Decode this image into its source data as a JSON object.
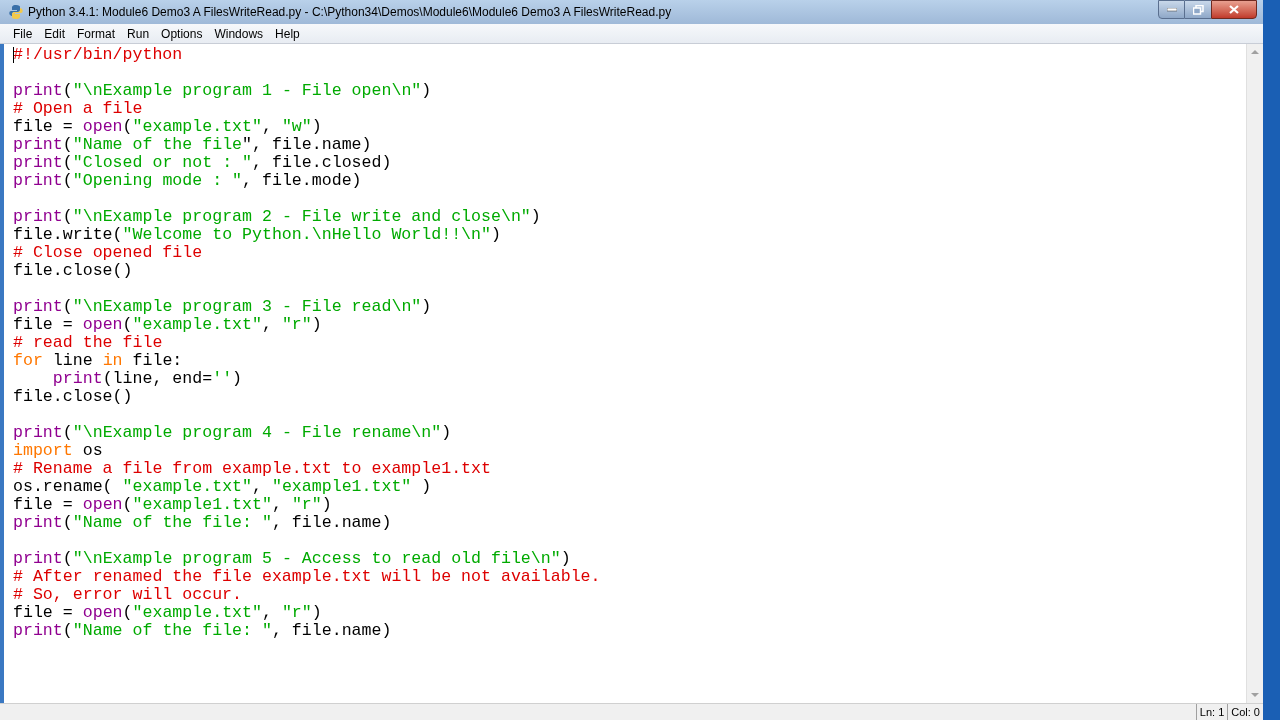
{
  "window": {
    "title": "Python 3.4.1: Module6 Demo3 A FilesWriteRead.py - C:\\Python34\\Demos\\Module6\\Module6 Demo3 A FilesWriteRead.py"
  },
  "menu": [
    "File",
    "Edit",
    "Format",
    "Run",
    "Options",
    "Windows",
    "Help"
  ],
  "code_lines": [
    {
      "kind": "code",
      "tokens": [
        {
          "kind": "comment",
          "text": "#!/usr/bin/python"
        }
      ]
    },
    {
      "kind": "blank"
    },
    {
      "kind": "code",
      "tokens": [
        {
          "kind": "builtin",
          "text": "print"
        },
        {
          "kind": "plain",
          "text": "("
        },
        {
          "kind": "string",
          "text": "\"\\nExample program 1 - File open\\n\""
        },
        {
          "kind": "plain",
          "text": ")"
        }
      ]
    },
    {
      "kind": "code",
      "tokens": [
        {
          "kind": "comment",
          "text": "# Open a file"
        }
      ]
    },
    {
      "kind": "code",
      "tokens": [
        {
          "kind": "plain",
          "text": "file = "
        },
        {
          "kind": "builtin",
          "text": "open"
        },
        {
          "kind": "plain",
          "text": "("
        },
        {
          "kind": "string",
          "text": "\"example.txt\""
        },
        {
          "kind": "plain",
          "text": ", "
        },
        {
          "kind": "string",
          "text": "\"w\""
        },
        {
          "kind": "plain",
          "text": ")"
        }
      ]
    },
    {
      "kind": "code",
      "tokens": [
        {
          "kind": "builtin",
          "text": "print"
        },
        {
          "kind": "plain",
          "text": "("
        },
        {
          "kind": "string",
          "text": "\"Name of the file"
        },
        {
          "kind": "plain",
          "text": "\", file.name)"
        }
      ]
    },
    {
      "kind": "code",
      "tokens": [
        {
          "kind": "builtin",
          "text": "print"
        },
        {
          "kind": "plain",
          "text": "("
        },
        {
          "kind": "string",
          "text": "\"Closed or not : \""
        },
        {
          "kind": "plain",
          "text": ", file.closed)"
        }
      ]
    },
    {
      "kind": "code",
      "tokens": [
        {
          "kind": "builtin",
          "text": "print"
        },
        {
          "kind": "plain",
          "text": "("
        },
        {
          "kind": "string",
          "text": "\"Opening mode : \""
        },
        {
          "kind": "plain",
          "text": ", file.mode)"
        }
      ]
    },
    {
      "kind": "blank"
    },
    {
      "kind": "code",
      "tokens": [
        {
          "kind": "builtin",
          "text": "print"
        },
        {
          "kind": "plain",
          "text": "("
        },
        {
          "kind": "string",
          "text": "\"\\nExample program 2 - File write and close\\n\""
        },
        {
          "kind": "plain",
          "text": ")"
        }
      ]
    },
    {
      "kind": "code",
      "tokens": [
        {
          "kind": "plain",
          "text": "file.write("
        },
        {
          "kind": "string",
          "text": "\"Welcome to Python.\\nHello World!!\\n\""
        },
        {
          "kind": "plain",
          "text": ")"
        }
      ]
    },
    {
      "kind": "code",
      "tokens": [
        {
          "kind": "comment",
          "text": "# Close opened file"
        }
      ]
    },
    {
      "kind": "code",
      "tokens": [
        {
          "kind": "plain",
          "text": "file.close()"
        }
      ]
    },
    {
      "kind": "blank"
    },
    {
      "kind": "code",
      "tokens": [
        {
          "kind": "builtin",
          "text": "print"
        },
        {
          "kind": "plain",
          "text": "("
        },
        {
          "kind": "string",
          "text": "\"\\nExample program 3 - File read\\n\""
        },
        {
          "kind": "plain",
          "text": ")"
        }
      ]
    },
    {
      "kind": "code",
      "tokens": [
        {
          "kind": "plain",
          "text": "file = "
        },
        {
          "kind": "builtin",
          "text": "open"
        },
        {
          "kind": "plain",
          "text": "("
        },
        {
          "kind": "string",
          "text": "\"example.txt\""
        },
        {
          "kind": "plain",
          "text": ", "
        },
        {
          "kind": "string",
          "text": "\"r\""
        },
        {
          "kind": "plain",
          "text": ")"
        }
      ]
    },
    {
      "kind": "code",
      "tokens": [
        {
          "kind": "comment",
          "text": "# read the file"
        }
      ]
    },
    {
      "kind": "code",
      "tokens": [
        {
          "kind": "keyword",
          "text": "for"
        },
        {
          "kind": "plain",
          "text": " line "
        },
        {
          "kind": "keyword",
          "text": "in"
        },
        {
          "kind": "plain",
          "text": " file:"
        }
      ]
    },
    {
      "kind": "code",
      "tokens": [
        {
          "kind": "builtin",
          "text": "    print"
        },
        {
          "kind": "plain",
          "text": "(line, end="
        },
        {
          "kind": "string",
          "text": "''"
        },
        {
          "kind": "plain",
          "text": ")"
        }
      ]
    },
    {
      "kind": "code",
      "tokens": [
        {
          "kind": "plain",
          "text": "file.close()"
        }
      ]
    },
    {
      "kind": "blank"
    },
    {
      "kind": "code",
      "tokens": [
        {
          "kind": "builtin",
          "text": "print"
        },
        {
          "kind": "plain",
          "text": "("
        },
        {
          "kind": "string",
          "text": "\"\\nExample program 4 - File rename\\n\""
        },
        {
          "kind": "plain",
          "text": ")"
        }
      ]
    },
    {
      "kind": "code",
      "tokens": [
        {
          "kind": "keyword",
          "text": "import"
        },
        {
          "kind": "plain",
          "text": " os"
        }
      ]
    },
    {
      "kind": "code",
      "tokens": [
        {
          "kind": "comment",
          "text": "# Rename a file from example.txt to example1.txt"
        }
      ]
    },
    {
      "kind": "code",
      "tokens": [
        {
          "kind": "plain",
          "text": "os.rename( "
        },
        {
          "kind": "string",
          "text": "\"example.txt\""
        },
        {
          "kind": "plain",
          "text": ", "
        },
        {
          "kind": "string",
          "text": "\"example1.txt\""
        },
        {
          "kind": "plain",
          "text": " )"
        }
      ]
    },
    {
      "kind": "code",
      "tokens": [
        {
          "kind": "plain",
          "text": "file = "
        },
        {
          "kind": "builtin",
          "text": "open"
        },
        {
          "kind": "plain",
          "text": "("
        },
        {
          "kind": "string",
          "text": "\"example1.txt\""
        },
        {
          "kind": "plain",
          "text": ", "
        },
        {
          "kind": "string",
          "text": "\"r\""
        },
        {
          "kind": "plain",
          "text": ")"
        }
      ]
    },
    {
      "kind": "code",
      "tokens": [
        {
          "kind": "builtin",
          "text": "print"
        },
        {
          "kind": "plain",
          "text": "("
        },
        {
          "kind": "string",
          "text": "\"Name of the file: \""
        },
        {
          "kind": "plain",
          "text": ", file.name)"
        }
      ]
    },
    {
      "kind": "blank"
    },
    {
      "kind": "code",
      "tokens": [
        {
          "kind": "builtin",
          "text": "print"
        },
        {
          "kind": "plain",
          "text": "("
        },
        {
          "kind": "string",
          "text": "\"\\nExample program 5 - Access to read old file\\n\""
        },
        {
          "kind": "plain",
          "text": ")"
        }
      ]
    },
    {
      "kind": "code",
      "tokens": [
        {
          "kind": "comment",
          "text": "# After renamed the file example.txt will be not available."
        }
      ]
    },
    {
      "kind": "code",
      "tokens": [
        {
          "kind": "comment",
          "text": "# So, error will occur."
        }
      ]
    },
    {
      "kind": "code",
      "tokens": [
        {
          "kind": "plain",
          "text": "file = "
        },
        {
          "kind": "builtin",
          "text": "open"
        },
        {
          "kind": "plain",
          "text": "("
        },
        {
          "kind": "string",
          "text": "\"example.txt\""
        },
        {
          "kind": "plain",
          "text": ", "
        },
        {
          "kind": "string",
          "text": "\"r\""
        },
        {
          "kind": "plain",
          "text": ")"
        }
      ]
    },
    {
      "kind": "code",
      "tokens": [
        {
          "kind": "builtin",
          "text": "print"
        },
        {
          "kind": "plain",
          "text": "("
        },
        {
          "kind": "string",
          "text": "\"Name of the file: \""
        },
        {
          "kind": "plain",
          "text": ", file.name)"
        }
      ]
    }
  ],
  "status_bar": {
    "line": "Ln: 1",
    "column": "Col: 0"
  }
}
